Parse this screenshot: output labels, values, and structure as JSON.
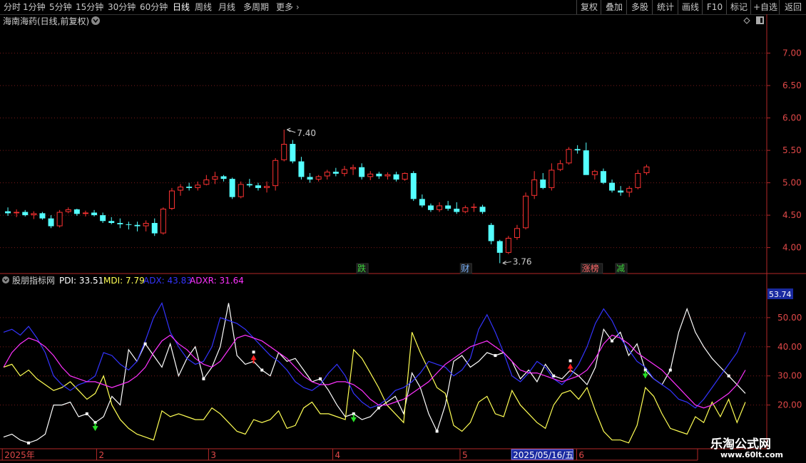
{
  "toolbar": {
    "periods": [
      "分时",
      "1分钟",
      "5分钟",
      "15分钟",
      "30分钟",
      "60分钟",
      "日线",
      "周线",
      "月线",
      "多周期",
      "更多"
    ],
    "active_period": "日线",
    "tools": [
      "复权",
      "叠加",
      "多股",
      "统计",
      "画线",
      "F10",
      "标记",
      "+自选",
      "返回"
    ]
  },
  "colors": {
    "up": "#ff3232",
    "down": "#54ffff",
    "pdi": "#ffffff",
    "mdi": "#ffff54",
    "adx": "#3434ff",
    "adxr": "#ff32ff",
    "axis": "#b42828",
    "grid": "#7a1a1a",
    "highlight": "#1a2aa0"
  },
  "chart_data": [
    {
      "type": "candlestick",
      "title": "海南海药(日线,前复权)",
      "y_ticks": [
        "7.00",
        "6.50",
        "6.00",
        "5.50",
        "5.00",
        "4.50",
        "4.00"
      ],
      "ylim": [
        3.6,
        7.6
      ],
      "annotations": {
        "high": "7.40",
        "low": "3.76"
      },
      "event_markers": [
        {
          "label": "跌",
          "bar": 41,
          "color": "#3cd23c"
        },
        {
          "label": "财",
          "bar": 53,
          "color": "#7ab4ff"
        },
        {
          "label": "涨榜",
          "bar": 67,
          "color": "#ff6a6a"
        },
        {
          "label": "减",
          "bar": 71,
          "color": "#3cd23c"
        }
      ],
      "ohlc": [
        [
          4.56,
          4.62,
          4.49,
          4.53
        ],
        [
          4.53,
          4.59,
          4.47,
          4.55
        ],
        [
          4.55,
          4.58,
          4.48,
          4.5
        ],
        [
          4.5,
          4.56,
          4.44,
          4.53
        ],
        [
          4.53,
          4.55,
          4.43,
          4.45
        ],
        [
          4.45,
          4.5,
          4.3,
          4.33
        ],
        [
          4.33,
          4.58,
          4.31,
          4.55
        ],
        [
          4.55,
          4.62,
          4.53,
          4.59
        ],
        [
          4.59,
          4.6,
          4.49,
          4.52
        ],
        [
          4.52,
          4.57,
          4.48,
          4.54
        ],
        [
          4.54,
          4.58,
          4.48,
          4.5
        ],
        [
          4.5,
          4.54,
          4.38,
          4.41
        ],
        [
          4.41,
          4.47,
          4.36,
          4.38
        ],
        [
          4.38,
          4.45,
          4.3,
          4.36
        ],
        [
          4.36,
          4.4,
          4.28,
          4.35
        ],
        [
          4.35,
          4.4,
          4.25,
          4.33
        ],
        [
          4.33,
          4.42,
          4.25,
          4.38
        ],
        [
          4.38,
          4.45,
          4.18,
          4.22
        ],
        [
          4.22,
          4.62,
          4.2,
          4.6
        ],
        [
          4.6,
          4.92,
          4.58,
          4.88
        ],
        [
          4.88,
          4.98,
          4.8,
          4.94
        ],
        [
          4.94,
          5.0,
          4.88,
          4.92
        ],
        [
          4.92,
          5.02,
          4.88,
          4.97
        ],
        [
          4.97,
          5.12,
          4.96,
          5.05
        ],
        [
          5.05,
          5.17,
          4.98,
          5.1
        ],
        [
          5.1,
          5.12,
          5.02,
          5.06
        ],
        [
          5.06,
          5.08,
          4.75,
          4.78
        ],
        [
          4.78,
          5.02,
          4.76,
          4.98
        ],
        [
          4.98,
          5.06,
          4.93,
          4.96
        ],
        [
          4.96,
          5.0,
          4.88,
          4.92
        ],
        [
          4.92,
          5.02,
          4.85,
          4.95
        ],
        [
          4.95,
          5.38,
          4.88,
          5.35
        ],
        [
          5.35,
          5.82,
          5.33,
          5.6
        ],
        [
          5.6,
          5.66,
          5.3,
          5.33
        ],
        [
          5.33,
          5.4,
          5.05,
          5.09
        ],
        [
          5.09,
          5.15,
          5.0,
          5.05
        ],
        [
          5.05,
          5.12,
          5.02,
          5.1
        ],
        [
          5.1,
          5.2,
          5.05,
          5.17
        ],
        [
          5.17,
          5.23,
          5.1,
          5.14
        ],
        [
          5.14,
          5.26,
          5.1,
          5.21
        ],
        [
          5.21,
          5.28,
          5.12,
          5.24
        ],
        [
          5.24,
          5.3,
          5.05,
          5.09
        ],
        [
          5.09,
          5.18,
          5.04,
          5.14
        ],
        [
          5.14,
          5.17,
          5.06,
          5.1
        ],
        [
          5.1,
          5.16,
          5.05,
          5.13
        ],
        [
          5.13,
          5.17,
          5.02,
          5.05
        ],
        [
          5.05,
          5.16,
          5.03,
          5.15
        ],
        [
          5.15,
          5.18,
          4.72,
          4.75
        ],
        [
          4.75,
          4.82,
          4.62,
          4.65
        ],
        [
          4.65,
          4.68,
          4.55,
          4.58
        ],
        [
          4.58,
          4.7,
          4.55,
          4.65
        ],
        [
          4.65,
          4.72,
          4.57,
          4.6
        ],
        [
          4.6,
          4.7,
          4.52,
          4.55
        ],
        [
          4.55,
          4.65,
          4.53,
          4.62
        ],
        [
          4.62,
          4.68,
          4.55,
          4.63
        ],
        [
          4.63,
          4.66,
          4.52,
          4.55
        ],
        [
          4.35,
          4.38,
          4.05,
          4.1
        ],
        [
          4.1,
          4.12,
          3.76,
          3.92
        ],
        [
          3.92,
          4.18,
          3.9,
          4.15
        ],
        [
          4.15,
          4.35,
          4.12,
          4.3
        ],
        [
          4.3,
          4.85,
          4.28,
          4.8
        ],
        [
          4.8,
          5.18,
          4.75,
          5.05
        ],
        [
          5.05,
          5.15,
          4.9,
          4.92
        ],
        [
          4.92,
          5.3,
          4.88,
          5.2
        ],
        [
          5.2,
          5.35,
          5.18,
          5.3
        ],
        [
          5.3,
          5.55,
          5.28,
          5.52
        ],
        [
          5.52,
          5.58,
          5.45,
          5.5
        ],
        [
          5.5,
          5.62,
          5.18,
          5.12
        ],
        [
          5.12,
          5.2,
          5.05,
          5.18
        ],
        [
          5.18,
          5.22,
          4.98,
          5.0
        ],
        [
          5.0,
          5.05,
          4.85,
          4.88
        ],
        [
          4.88,
          4.95,
          4.8,
          4.85
        ],
        [
          4.85,
          4.95,
          4.78,
          4.92
        ],
        [
          4.92,
          5.2,
          4.9,
          5.15
        ],
        [
          5.15,
          5.28,
          5.12,
          5.25
        ]
      ]
    },
    {
      "type": "line",
      "title": "股朋指标网",
      "legend": [
        {
          "label": "PDI: 33.51",
          "color": "#ffffff"
        },
        {
          "label": "MDI: 7.79",
          "color": "#ffff54"
        },
        {
          "label": "ADX: 43.83",
          "color": "#3434ff"
        },
        {
          "label": "ADXR: 31.64",
          "color": "#ff32ff"
        }
      ],
      "y_ticks": [
        "50.00",
        "40.00",
        "30.00",
        "20.00"
      ],
      "ylim": [
        5,
        60
      ],
      "current_value": "53.74",
      "x_labels": [
        {
          "text": "2025年",
          "pos": 0.003
        },
        {
          "text": "2",
          "pos": 0.126
        },
        {
          "text": "3",
          "pos": 0.272
        },
        {
          "text": "4",
          "pos": 0.434
        },
        {
          "text": "5",
          "pos": 0.6
        },
        {
          "text": "2025/05/16/五",
          "pos": 0.668,
          "highlight": true
        },
        {
          "text": "6",
          "pos": 0.752
        }
      ],
      "x": [
        0,
        1,
        2,
        3,
        4,
        5,
        6,
        7,
        8,
        9,
        10,
        11,
        12,
        13,
        14,
        15,
        16,
        17,
        18,
        19,
        20,
        21,
        22,
        23,
        24,
        25,
        26,
        27,
        28,
        29,
        30,
        31,
        32,
        33,
        34,
        35,
        36,
        37,
        38,
        39,
        40,
        41,
        42,
        43,
        44,
        45,
        46,
        47,
        48,
        49,
        50,
        51,
        52,
        53,
        54,
        55,
        56,
        57,
        58,
        59,
        60,
        61,
        62,
        63,
        64,
        65,
        66,
        67,
        68,
        69,
        70,
        71,
        72,
        73,
        74,
        75,
        76,
        77,
        78,
        79,
        80,
        81,
        82,
        83,
        84,
        85,
        86,
        87,
        88,
        89
      ],
      "series": [
        {
          "name": "PDI",
          "color": "#ffffff",
          "values": [
            9,
            10,
            8,
            7,
            8,
            10,
            20,
            20,
            21,
            16,
            17,
            14,
            16,
            23,
            20,
            39,
            35,
            41,
            37,
            33,
            41,
            30,
            36,
            40,
            29,
            33,
            40,
            55,
            37,
            34,
            35,
            32,
            30,
            38,
            35,
            36,
            32,
            28,
            29,
            25,
            20,
            16,
            17,
            15,
            16,
            19,
            21,
            23,
            17,
            31,
            26,
            17,
            11,
            20,
            35,
            37,
            33,
            35,
            38,
            37,
            38,
            35,
            29,
            32,
            28,
            34,
            30,
            29,
            32,
            30,
            27,
            33,
            46,
            42,
            45,
            37,
            41,
            32,
            29,
            27,
            32,
            45,
            53,
            45,
            40,
            36,
            33,
            30,
            27,
            24
          ]
        },
        {
          "name": "MDI",
          "color": "#ffff54",
          "values": [
            33,
            34,
            30,
            32,
            29,
            27,
            25,
            26,
            28,
            25,
            22,
            24,
            30,
            20,
            15,
            12,
            10,
            9,
            8,
            18,
            16,
            17,
            16,
            15,
            15,
            19,
            17,
            14,
            11,
            10,
            15,
            14,
            15,
            18,
            12,
            13,
            19,
            21,
            17,
            17,
            16,
            15,
            39,
            36,
            31,
            26,
            20,
            17,
            14,
            45,
            38,
            32,
            26,
            24,
            13,
            11,
            14,
            21,
            23,
            17,
            16,
            25,
            20,
            17,
            14,
            12,
            20,
            24,
            25,
            22,
            26,
            18,
            11,
            8,
            8,
            7,
            13,
            26,
            23,
            17,
            12,
            11,
            10,
            16,
            14,
            21,
            16,
            22,
            14,
            21
          ]
        },
        {
          "name": "ADX",
          "color": "#3434ff",
          "values": [
            45,
            46,
            44,
            47,
            43,
            38,
            30,
            27,
            25,
            27,
            28,
            30,
            38,
            37,
            34,
            32,
            35,
            42,
            50,
            55,
            45,
            40,
            36,
            34,
            35,
            40,
            50,
            49,
            48,
            46,
            43,
            40,
            37,
            35,
            32,
            28,
            26,
            25,
            27,
            31,
            34,
            30,
            24,
            21,
            19,
            20,
            22,
            25,
            26,
            28,
            31,
            35,
            34,
            33,
            30,
            32,
            36,
            46,
            51,
            45,
            38,
            30,
            28,
            31,
            35,
            33,
            29,
            27,
            30,
            34,
            40,
            48,
            53,
            49,
            43,
            39,
            35,
            33,
            29,
            27,
            25,
            22,
            21,
            19,
            22,
            26,
            30,
            34,
            38,
            45
          ]
        },
        {
          "name": "ADXR",
          "color": "#ff32ff",
          "values": [
            33,
            38,
            41,
            43,
            42,
            40,
            37,
            33,
            30,
            29,
            28,
            28,
            27,
            26,
            27,
            28,
            30,
            33,
            38,
            42,
            44,
            41,
            39,
            36,
            34,
            33,
            35,
            39,
            43,
            44,
            43,
            42,
            40,
            38,
            36,
            33,
            30,
            28,
            27,
            27,
            28,
            28,
            27,
            25,
            22,
            20,
            20,
            21,
            22,
            24,
            26,
            28,
            31,
            34,
            36,
            38,
            40,
            41,
            42,
            40,
            38,
            35,
            32,
            31,
            31,
            30,
            29,
            28,
            29,
            30,
            32,
            36,
            41,
            44,
            43,
            41,
            38,
            36,
            34,
            32,
            29,
            26,
            23,
            20,
            19,
            20,
            22,
            24,
            27,
            32
          ]
        }
      ],
      "signals": [
        {
          "bar": 11,
          "kind": "buy"
        },
        {
          "bar": 30,
          "kind": "sell"
        },
        {
          "bar": 42,
          "kind": "buy"
        },
        {
          "bar": 68,
          "kind": "sell"
        },
        {
          "bar": 77,
          "kind": "buy"
        }
      ]
    }
  ],
  "watermark": {
    "title": "乐淘公式网",
    "url": "www.60lt.com"
  }
}
